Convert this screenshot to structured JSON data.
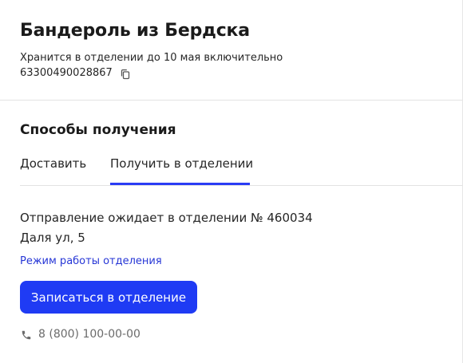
{
  "parcel": {
    "title": "Бандероль из Бердска",
    "storage_info": "Хранится в отделении до 10 мая включительно",
    "tracking_number": "63300490028867"
  },
  "receiving": {
    "section_title": "Способы получения",
    "tabs": [
      {
        "label": "Доставить",
        "active": false
      },
      {
        "label": "Получить в отделении",
        "active": true
      }
    ]
  },
  "office": {
    "awaiting_text": "Отправление ожидает в отделении № 460034",
    "address": "Даля ул, 5",
    "hours_link": "Режим работы отделения",
    "book_button": "Записаться в отделение",
    "phone": "8 (800) 100-00-00"
  },
  "colors": {
    "accent": "#1f3bf4",
    "link": "#2636d6"
  },
  "icons": {
    "copy": "copy-icon",
    "phone": "phone-icon"
  }
}
